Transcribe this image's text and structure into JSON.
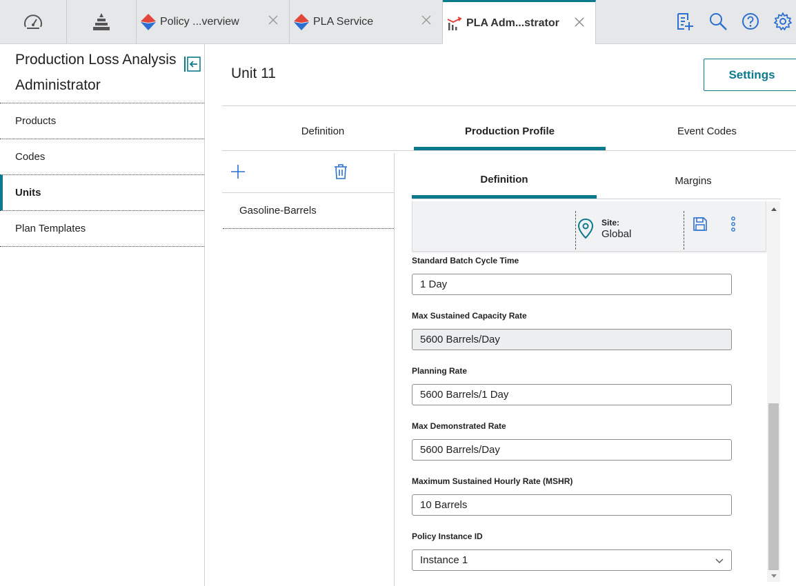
{
  "topbar": {
    "tabs": [
      {
        "label": "Policy ...verview",
        "icon": "policy-diamond-icon"
      },
      {
        "label": "PLA Service",
        "icon": "policy-diamond-icon"
      },
      {
        "label": "PLA Adm...strator",
        "icon": "pla-chart-icon",
        "active": true
      }
    ],
    "left_icons": [
      "dashboard-icon",
      "hierarchy-icon"
    ],
    "right_icons": [
      "new-record-icon",
      "search-icon",
      "help-icon",
      "settings-gear-icon"
    ]
  },
  "leftnav": {
    "title": "Production Loss Analysis Administrator",
    "items": [
      {
        "label": "Products"
      },
      {
        "label": "Codes"
      },
      {
        "label": "Units",
        "selected": true
      },
      {
        "label": "Plan Templates"
      }
    ]
  },
  "main": {
    "title": "Unit 11",
    "settings_label": "Settings",
    "tabs": [
      {
        "label": "Definition"
      },
      {
        "label": "Production Profile",
        "active": true
      },
      {
        "label": "Event Codes"
      }
    ]
  },
  "product_list": {
    "items": [
      {
        "label": "Gasoline-Barrels"
      }
    ]
  },
  "detail": {
    "tabs": [
      {
        "label": "Definition",
        "active": true
      },
      {
        "label": "Margins"
      }
    ],
    "site": {
      "label": "Site:",
      "value": "Global"
    },
    "fields": [
      {
        "label": "Standard Batch Cycle Time",
        "value": "1 Day",
        "readonly": false
      },
      {
        "label": "Max Sustained Capacity Rate",
        "value": "5600 Barrels/Day",
        "readonly": true
      },
      {
        "label": "Planning Rate",
        "value": "5600 Barrels/1 Day",
        "readonly": false
      },
      {
        "label": "Max Demonstrated Rate",
        "value": "5600 Barrels/Day",
        "readonly": false
      },
      {
        "label": "Maximum Sustained Hourly Rate (MSHR)",
        "value": "10 Barrels",
        "readonly": false
      }
    ],
    "policy_instance": {
      "label": "Policy Instance ID",
      "value": "Instance 1"
    }
  },
  "colors": {
    "accent": "#0b7a8c",
    "policy_red": "#e2463a",
    "policy_blue": "#2a6fd1"
  }
}
